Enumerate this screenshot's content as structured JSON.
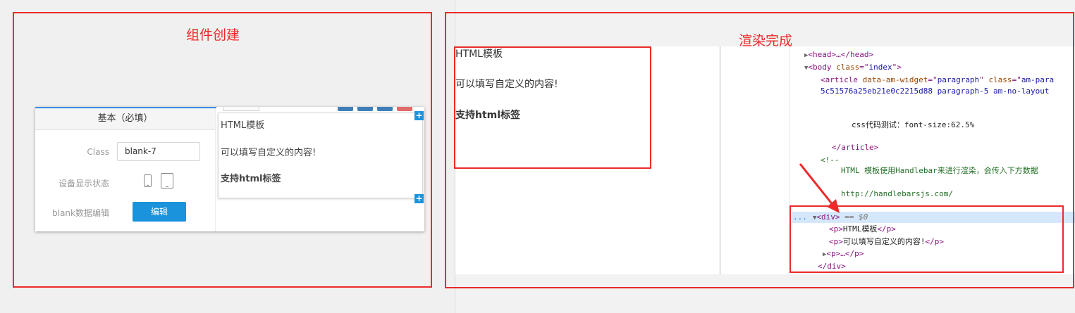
{
  "left_section": {
    "annotation": "组件创建",
    "panel_title": "基本（必填）",
    "class_label": "Class",
    "class_value": "blank-7",
    "device_label": "设备显示状态",
    "blank_label": "blank数据编辑",
    "edit_button": "编辑",
    "preview": {
      "line1": "HTML模板",
      "line2": "可以填写自定义的内容!",
      "line3": "支持html标签"
    }
  },
  "right_section": {
    "annotation": "渲染完成",
    "rendered": {
      "line1": "HTML模板",
      "line2": "可以填写自定义的内容!",
      "line3": "支持html标签"
    },
    "devtools": {
      "head": "<head>…</head>",
      "body_tag": "body",
      "body_class": "index",
      "article_widget": "paragraph",
      "article_class_partial": "am-para",
      "article_class_cont": "5c51576a25eb21e0c2215d88 paragraph-5 am-no-layout",
      "css_text": "css代码测试：font-size:62.5%",
      "article_close": "</article>",
      "comment_open": "<!--",
      "comment_text": "HTML 模板使用Handlebar来进行渲染，会传入下方数据",
      "comment_url": "http://handlebarsjs.com/",
      "div_open": "<div>",
      "div_eq": "== $0",
      "p1": "HTML模板",
      "p2": "可以填写自定义的内容!",
      "p3": "<p>…</p>",
      "div_close": "</div>",
      "dots": "..."
    }
  },
  "colors": {
    "annotation_red": "#ec2a2a",
    "accent_blue": "#1a93dc"
  }
}
